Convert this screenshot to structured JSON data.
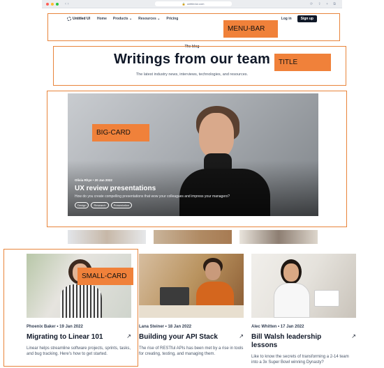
{
  "browser": {
    "url": "untitledui.com"
  },
  "menu": {
    "logo": "Untitled UI",
    "nav_items": [
      "Home",
      "Products ⌄",
      "Resources ⌄",
      "Pricing"
    ],
    "login": "Log in",
    "signup": "Sign up"
  },
  "hero": {
    "eyebrow": "The blog",
    "headline": "Writings from our team",
    "subline": "The latest industry news, interviews, technologies, and resources."
  },
  "big_card": {
    "meta": "Olivia Rhye • 20 Jan 2022",
    "title": "UX review presentations",
    "description": "How do you create compelling presentations that wow your colleagues and impress your managers?",
    "tags": [
      "Design",
      "Research",
      "Presentation"
    ]
  },
  "small_cards": [
    {
      "meta": "Phoenix Baker • 19 Jan 2022",
      "title": "Migrating to Linear 101",
      "description": "Linear helps streamline software projects, sprints, tasks, and bug tracking. Here's how to get started."
    },
    {
      "meta": "Lana Steiner • 18 Jan 2022",
      "title": "Building your API Stack",
      "description": "The rise of RESTful APIs has been met by a rise in tools for creating, testing, and managing them."
    },
    {
      "meta": "Alec Whitten • 17 Jan 2022",
      "title": "Bill Walsh leadership lessons",
      "description": "Like to know the secrets of transforming a 2-14 team into a 3x Super Bowl winning Dynasty?"
    }
  ],
  "annotations": {
    "menu_bar": "MENU-BAR",
    "title": "TITLE",
    "big_card": "BIG-CARD",
    "small_card": "SMALL-CARD"
  },
  "colors": {
    "annotation": "#f0813a",
    "button": "#101828"
  }
}
